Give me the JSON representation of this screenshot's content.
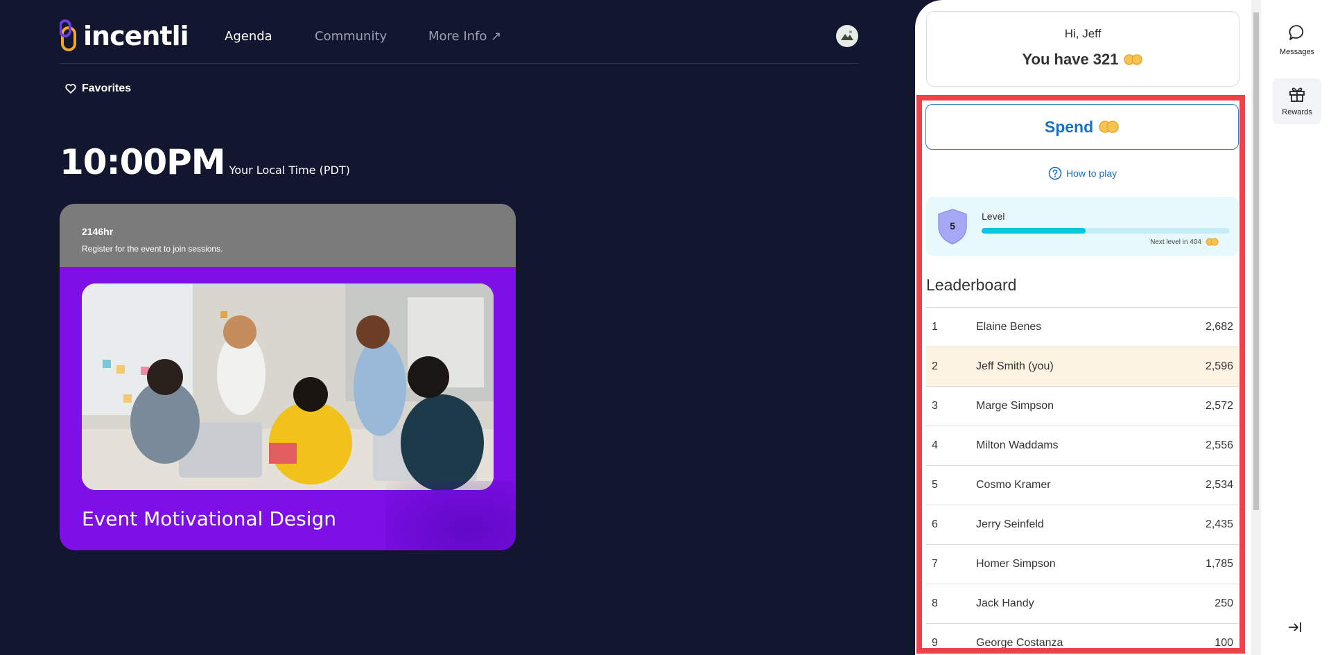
{
  "brand": {
    "name": "incentli"
  },
  "nav": {
    "agenda": "Agenda",
    "community": "Community",
    "more_info": "More Info ↗"
  },
  "favorites": {
    "label": "Favorites"
  },
  "clock": {
    "time": "10:00PM",
    "zone_label": "Your Local Time (PDT)"
  },
  "event": {
    "hours": "2146hr",
    "note": "Register for the event to join sessions.",
    "title": "Event Motivational Design"
  },
  "wallet": {
    "greeting": "Hi, Jeff",
    "balance_text": "You have 321"
  },
  "spend": {
    "label": "Spend"
  },
  "how_to_play": {
    "label": "How to play"
  },
  "level": {
    "number": "5",
    "label": "Level",
    "progress": 0.42,
    "next_text": "Next level in 404"
  },
  "leaderboard": {
    "title": "Leaderboard",
    "rows": [
      {
        "rank": "1",
        "name": "Elaine Benes",
        "points": "2,682"
      },
      {
        "rank": "2",
        "name": "Jeff Smith (you)",
        "points": "2,596"
      },
      {
        "rank": "3",
        "name": "Marge Simpson",
        "points": "2,572"
      },
      {
        "rank": "4",
        "name": "Milton Waddams",
        "points": "2,556"
      },
      {
        "rank": "5",
        "name": "Cosmo Kramer",
        "points": "2,534"
      },
      {
        "rank": "6",
        "name": "Jerry Seinfeld",
        "points": "2,435"
      },
      {
        "rank": "7",
        "name": "Homer Simpson",
        "points": "1,785"
      },
      {
        "rank": "8",
        "name": "Jack Handy",
        "points": "250"
      },
      {
        "rank": "9",
        "name": "George Costanza",
        "points": "100"
      }
    ]
  },
  "rail": {
    "messages": "Messages",
    "rewards": "Rewards"
  },
  "colors": {
    "background": "#12162f",
    "event_purple": "#7e0fe6",
    "accent_blue": "#1d6fc2",
    "level_cyan": "#0ec3e8",
    "highlight_red": "#f04048"
  },
  "icons": [
    "heart-icon",
    "question-circle-icon",
    "coin-icon",
    "shield-icon",
    "chat-bubble-icon",
    "gift-icon",
    "collapse-right-icon"
  ]
}
